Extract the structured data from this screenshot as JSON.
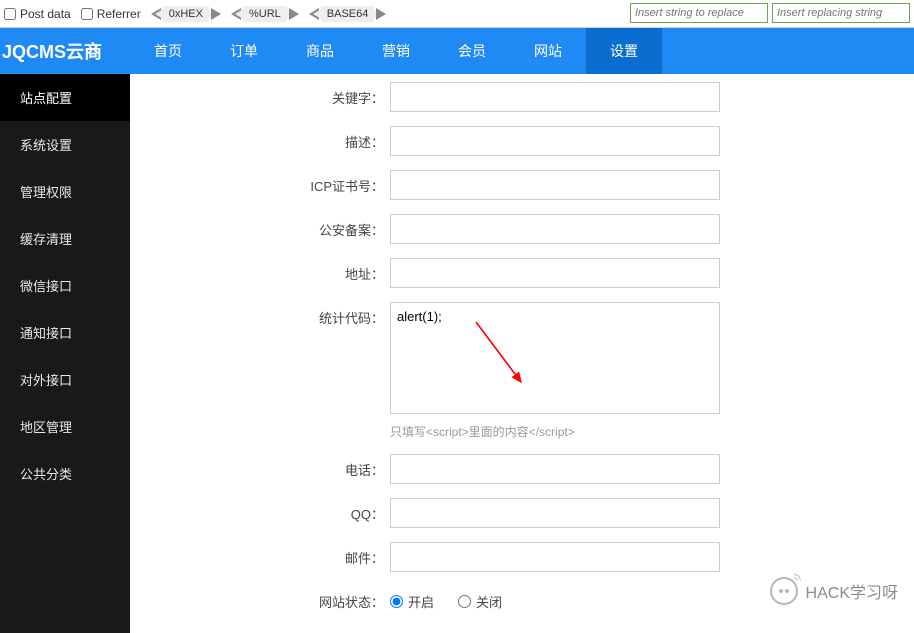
{
  "toolbar": {
    "post_data": "Post data",
    "referrer": "Referrer",
    "hex_btn": "0xHEX",
    "url_btn": "%URL",
    "base64_btn": "BASE64",
    "replace_from_placeholder": "Insert string to replace",
    "replace_to_placeholder": "Insert replacing string"
  },
  "brand": "JQCMS云商",
  "nav": [
    "首页",
    "订单",
    "商品",
    "营销",
    "会员",
    "网站",
    "设置"
  ],
  "nav_active_index": 6,
  "sidebar": [
    "站点配置",
    "系统设置",
    "管理权限",
    "缓存清理",
    "微信接口",
    "通知接口",
    "对外接口",
    "地区管理",
    "公共分类"
  ],
  "sidebar_active_index": 0,
  "form": {
    "keyword": {
      "label": "关键字：",
      "value": ""
    },
    "desc": {
      "label": "描述：",
      "value": ""
    },
    "icp": {
      "label": "ICP证书号：",
      "value": ""
    },
    "police": {
      "label": "公安备案：",
      "value": ""
    },
    "address": {
      "label": "地址：",
      "value": ""
    },
    "stat": {
      "label": "统计代码：",
      "value": "alert(1);",
      "help": "只填写<script>里面的内容</script>"
    },
    "phone": {
      "label": "电话：",
      "value": ""
    },
    "qq": {
      "label": "QQ：",
      "value": ""
    },
    "email": {
      "label": "邮件：",
      "value": ""
    },
    "status": {
      "label": "网站状态：",
      "on": "开启",
      "off": "关闭"
    }
  },
  "watermark": "HACK学习呀"
}
